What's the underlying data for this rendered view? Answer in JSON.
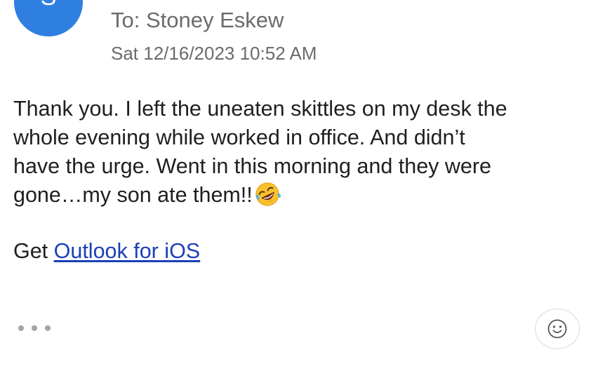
{
  "sender": {
    "avatar_initial": "S",
    "avatar_color": "#2f7fe0"
  },
  "header": {
    "recipient": "To: Stoney Eskew",
    "timestamp": "Sat 12/16/2023 10:52 AM"
  },
  "message": {
    "lines": [
      "Thank you. I left the uneaten skittles on my desk the",
      "whole evening while worked in office. And didn’t",
      "have the urge. Went in this morning and they were",
      "gone…my son ate them!!"
    ],
    "emoji": "rolling-on-floor-laughing-emoji"
  },
  "signature": {
    "prefix": "Get ",
    "link_text": "Outlook for iOS",
    "link_color": "#1a3fb8"
  },
  "actions": {
    "more_icon": "more-horizontal-icon",
    "react_icon": "smiley-icon"
  }
}
